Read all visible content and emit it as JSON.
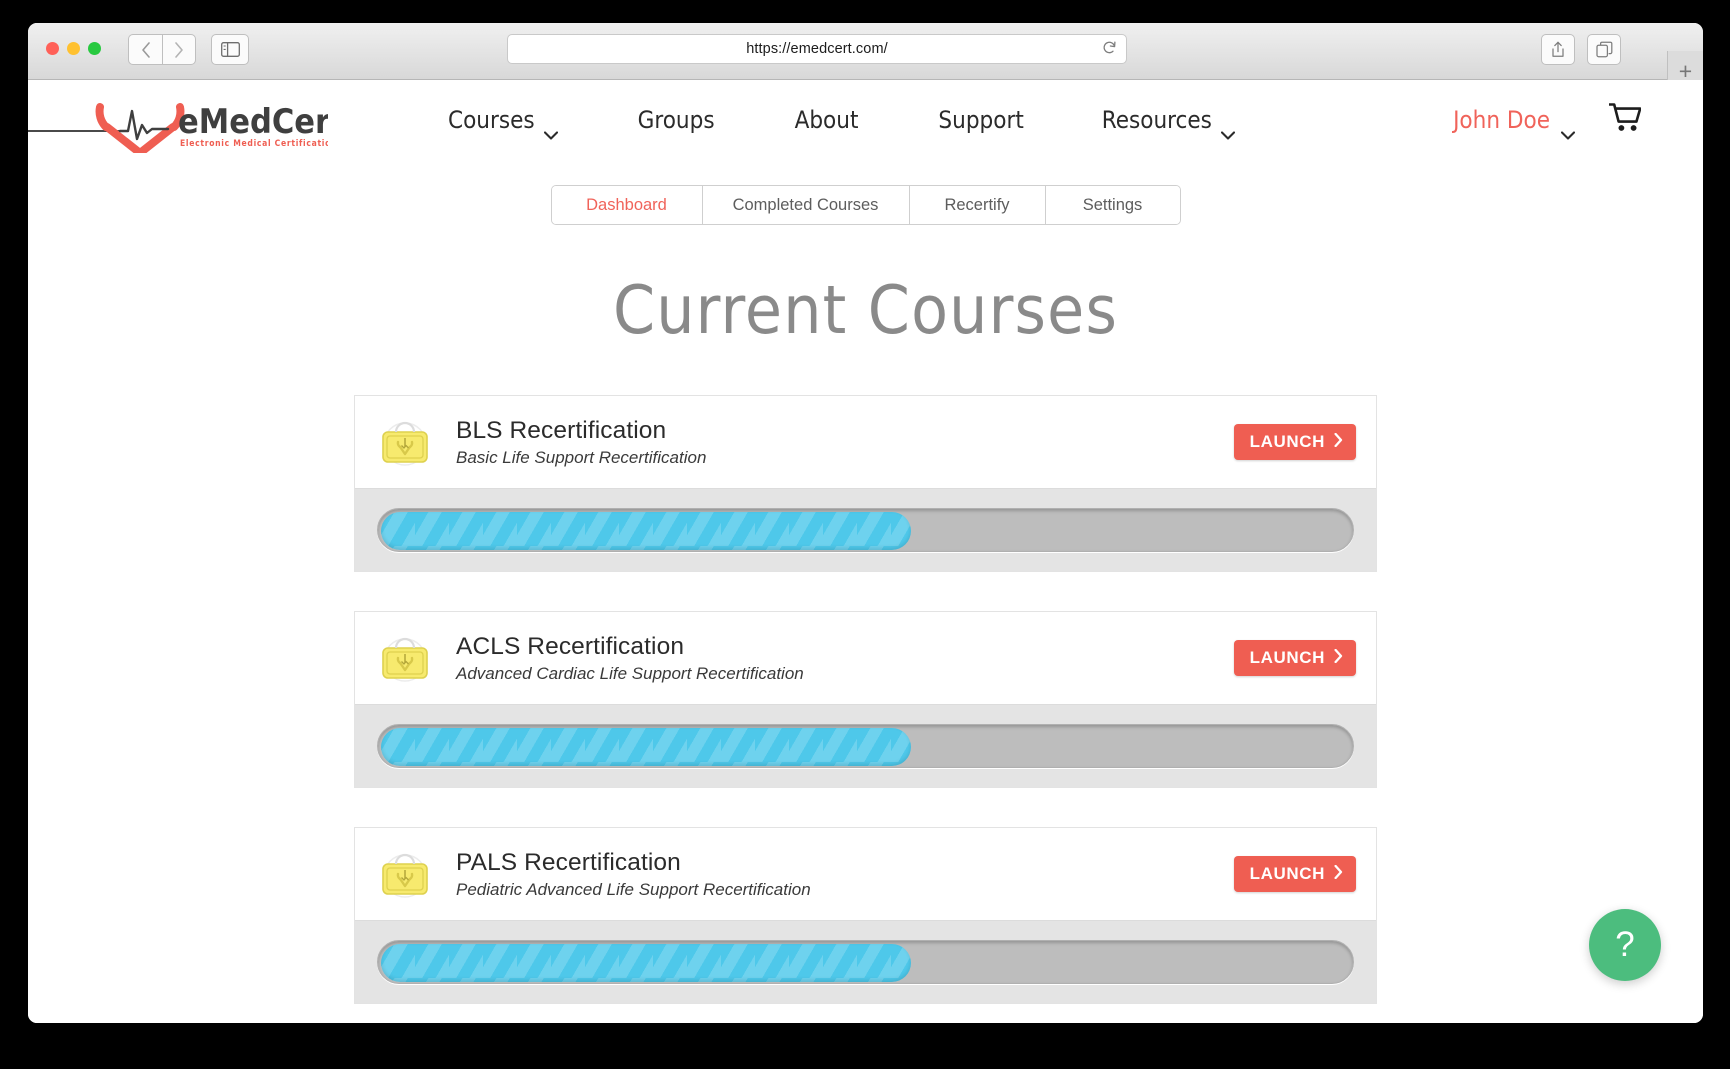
{
  "browser": {
    "url": "https://emedcert.com/",
    "traffic_lights": [
      "close-red",
      "minimize-yellow",
      "maximize-green"
    ],
    "back_icon": "chevron-left-icon",
    "forward_icon": "chevron-right-icon",
    "sidebar_icon": "sidebar-toggle-icon",
    "reload_icon": "reload-icon",
    "share_icon": "share-icon",
    "tabs_icon": "show-tabs-icon",
    "new_tab_label": "+"
  },
  "site": {
    "logo": {
      "name": "eMedCert",
      "tagline": "Electronic  Medical  Certification",
      "icon": "ekg-heart-logo-icon",
      "accent": "#ef5e52"
    },
    "nav": [
      {
        "label": "Courses",
        "caret": true,
        "icon": "chevron-down-icon"
      },
      {
        "label": "Groups",
        "caret": false
      },
      {
        "label": "About",
        "caret": false
      },
      {
        "label": "Support",
        "caret": false
      },
      {
        "label": "Resources",
        "caret": true,
        "icon": "chevron-down-icon"
      }
    ],
    "user": {
      "label": "John Doe",
      "caret": true,
      "icon": "chevron-down-icon",
      "color": "#f0635a"
    },
    "cart": {
      "icon": "shopping-cart-icon"
    }
  },
  "tabs": [
    {
      "label": "Dashboard",
      "active": true
    },
    {
      "label": "Completed Courses",
      "active": false
    },
    {
      "label": "Recertify",
      "active": false
    },
    {
      "label": "Settings",
      "active": false
    }
  ],
  "main": {
    "title": "Current Courses"
  },
  "courses": [
    {
      "name": "BLS Recertification",
      "description": "Basic Life Support Recertification",
      "icon": "medical-bag-icon",
      "launch_label": "LAUNCH",
      "launch_icon": "chevron-right-icon",
      "progress_percent": 55
    },
    {
      "name": "ACLS Recertification",
      "description": "Advanced Cardiac Life Support Recertification",
      "icon": "medical-bag-icon",
      "launch_label": "LAUNCH",
      "launch_icon": "chevron-right-icon",
      "progress_percent": 55
    },
    {
      "name": "PALS Recertification",
      "description": "Pediatric Advanced Life Support Recertification",
      "icon": "medical-bag-icon",
      "launch_label": "LAUNCH",
      "launch_icon": "chevron-right-icon",
      "progress_percent": 55
    }
  ],
  "help": {
    "label": "?",
    "icon": "question-mark-icon",
    "color": "#4cbd7e"
  }
}
